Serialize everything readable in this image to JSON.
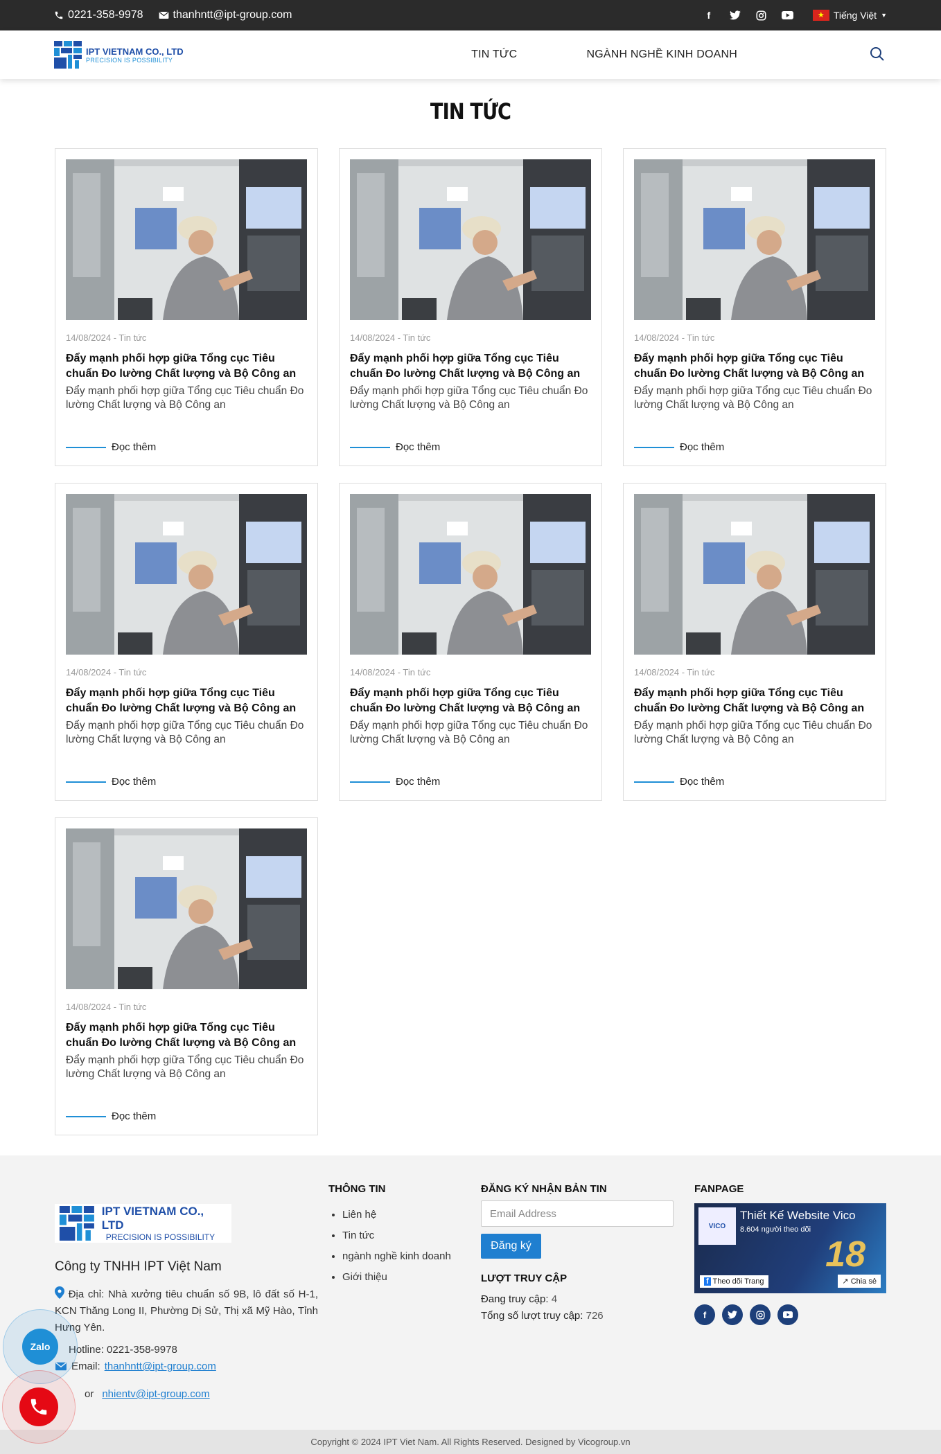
{
  "topbar": {
    "phone": "0221-358-9978",
    "email": "thanhntt@ipt-group.com",
    "language": "Tiếng Việt",
    "social_icons": [
      "facebook-icon",
      "twitter-icon",
      "instagram-icon",
      "youtube-icon"
    ]
  },
  "header": {
    "logo_name": "IPT VIETNAM CO., LTD",
    "logo_tagline": "PRECISION IS POSSIBILITY",
    "nav": [
      "TIN TỨC",
      "NGÀNH NGHỀ KINH DOANH"
    ]
  },
  "page": {
    "title": "TIN TỨC"
  },
  "posts": [
    {
      "date": "14/08/2024",
      "category": "Tin tức",
      "title": "Đẩy mạnh phối hợp giữa Tổng cục Tiêu chuẩn Đo lường Chất lượng và Bộ Công an",
      "excerpt": "Đẩy mạnh phối hợp giữa Tổng cục Tiêu chuẩn Đo lường Chất lượng và Bộ Công an",
      "read_more": "Đọc thêm"
    },
    {
      "date": "14/08/2024",
      "category": "Tin tức",
      "title": "Đẩy mạnh phối hợp giữa Tổng cục Tiêu chuẩn Đo lường Chất lượng và Bộ Công an",
      "excerpt": "Đẩy mạnh phối hợp giữa Tổng cục Tiêu chuẩn Đo lường Chất lượng và Bộ Công an",
      "read_more": "Đọc thêm"
    },
    {
      "date": "14/08/2024",
      "category": "Tin tức",
      "title": "Đẩy mạnh phối hợp giữa Tổng cục Tiêu chuẩn Đo lường Chất lượng và Bộ Công an",
      "excerpt": "Đẩy mạnh phối hợp giữa Tổng cục Tiêu chuẩn Đo lường Chất lượng và Bộ Công an",
      "read_more": "Đọc thêm"
    },
    {
      "date": "14/08/2024",
      "category": "Tin tức",
      "title": "Đẩy mạnh phối hợp giữa Tổng cục Tiêu chuẩn Đo lường Chất lượng và Bộ Công an",
      "excerpt": "Đẩy mạnh phối hợp giữa Tổng cục Tiêu chuẩn Đo lường Chất lượng và Bộ Công an",
      "read_more": "Đọc thêm"
    },
    {
      "date": "14/08/2024",
      "category": "Tin tức",
      "title": "Đẩy mạnh phối hợp giữa Tổng cục Tiêu chuẩn Đo lường Chất lượng và Bộ Công an",
      "excerpt": "Đẩy mạnh phối hợp giữa Tổng cục Tiêu chuẩn Đo lường Chất lượng và Bộ Công an",
      "read_more": "Đọc thêm"
    },
    {
      "date": "14/08/2024",
      "category": "Tin tức",
      "title": "Đẩy mạnh phối hợp giữa Tổng cục Tiêu chuẩn Đo lường Chất lượng và Bộ Công an",
      "excerpt": "Đẩy mạnh phối hợp giữa Tổng cục Tiêu chuẩn Đo lường Chất lượng và Bộ Công an",
      "read_more": "Đọc thêm"
    },
    {
      "date": "14/08/2024",
      "category": "Tin tức",
      "title": "Đẩy mạnh phối hợp giữa Tổng cục Tiêu chuẩn Đo lường Chất lượng và Bộ Công an",
      "excerpt": "Đẩy mạnh phối hợp giữa Tổng cục Tiêu chuẩn Đo lường Chất lượng và Bộ Công an",
      "read_more": "Đọc thêm"
    }
  ],
  "footer": {
    "logo_name": "IPT VIETNAM CO., LTD",
    "logo_tagline": "PRECISION IS POSSIBILITY",
    "company": "Công ty TNHH IPT Việt Nam",
    "address": "Địa chỉ: Nhà xưởng tiêu chuẩn số 9B, lô đất số H-1, KCN Thăng Long II, Phường Dị Sử, Thị xã Mỹ Hào, Tỉnh Hưng Yên.",
    "hotline": "Hotline: 0221-358-9978",
    "email_label": "Email:",
    "email": "thanhntt@ipt-group.com",
    "or_label": "or",
    "email2": "nhientv@ipt-group.com",
    "info_heading": "THÔNG TIN",
    "info_links": [
      "Liên hệ",
      "Tin tức",
      "ngành nghề kinh doanh",
      "Giới thiệu"
    ],
    "newsletter_heading": "ĐĂNG KÝ NHẬN BẢN TIN",
    "email_placeholder": "Email Address",
    "subscribe": "Đăng ký",
    "visits_heading": "LƯỢT TRUY CẬP",
    "online_label": "Đang truy cập:",
    "online_value": "4",
    "total_label": "Tổng số lượt truy cập:",
    "total_value": "726",
    "fanpage_heading": "FANPAGE",
    "fanpage_name": "Thiết Kế Website Vico",
    "fanpage_followers": "8.604 người theo dõi",
    "fanpage_follow": "Theo dõi Trang",
    "fanpage_share": "Chia sẻ",
    "fanpage_logo": "VICO",
    "fanpage_badge": "18",
    "copyright": "Copyright © 2024 IPT Viet Nam. All Rights Reserved. Designed by Vicogroup.vn"
  },
  "floating": {
    "zalo": "Zalo"
  }
}
